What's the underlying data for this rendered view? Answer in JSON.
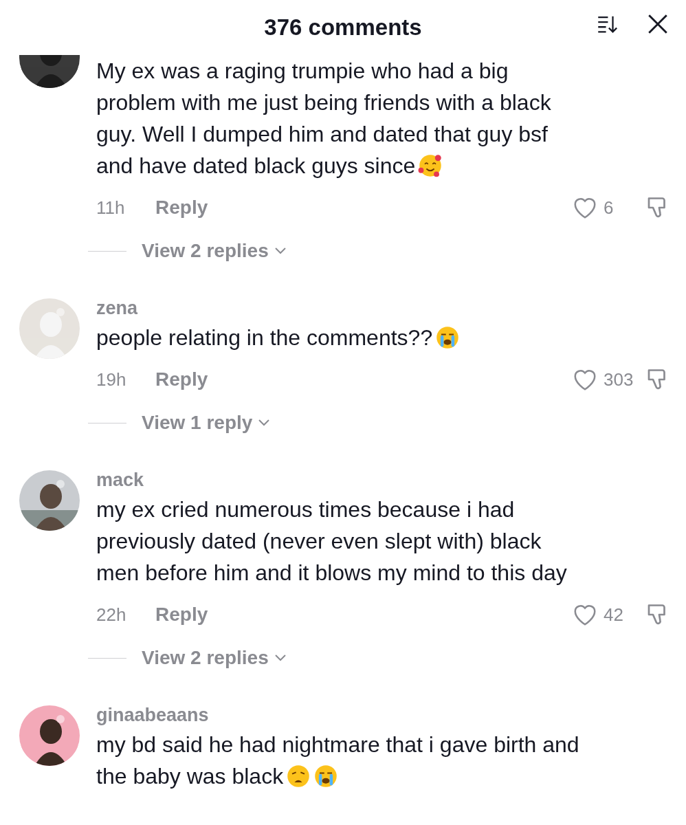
{
  "header": {
    "title": "376 comments"
  },
  "comments": [
    {
      "avatar": {
        "kind": "picture",
        "cropped": true
      },
      "lines": [
        "My ex was a raging trumpie who had a big",
        "problem with me just being friends with a black",
        "guy. Well I dumped him and dated that guy bsf",
        "and have dated black guys since"
      ],
      "emojis": [
        {
          "kind": "hearts"
        }
      ],
      "time": "11h",
      "reply": "Reply",
      "likes": "6",
      "view_replies": "View 2 replies"
    },
    {
      "username": "zena",
      "avatar": {
        "kind": "picture",
        "cropped": false
      },
      "lines": [
        "people relating in the comments??"
      ],
      "emojis": [
        {
          "kind": "crying"
        }
      ],
      "time": "19h",
      "reply": "Reply",
      "likes": "303",
      "view_replies": "View 1 reply"
    },
    {
      "username": "mack",
      "avatar": {
        "kind": "picture",
        "cropped": false
      },
      "lines": [
        "my ex cried numerous times because i had",
        "previously dated (never even slept with) black",
        "men before him and it blows my mind to this day"
      ],
      "time": "22h",
      "reply": "Reply",
      "likes": "42",
      "view_replies": "View 2 replies"
    },
    {
      "username": "ginaabeaans",
      "avatar": {
        "kind": "picture",
        "cropped": false
      },
      "lines": [
        "my bd said he had nightmare that i gave birth and",
        "the baby was black"
      ],
      "emojis": [
        {
          "kind": "weary"
        },
        {
          "kind": "crying"
        }
      ]
    }
  ]
}
